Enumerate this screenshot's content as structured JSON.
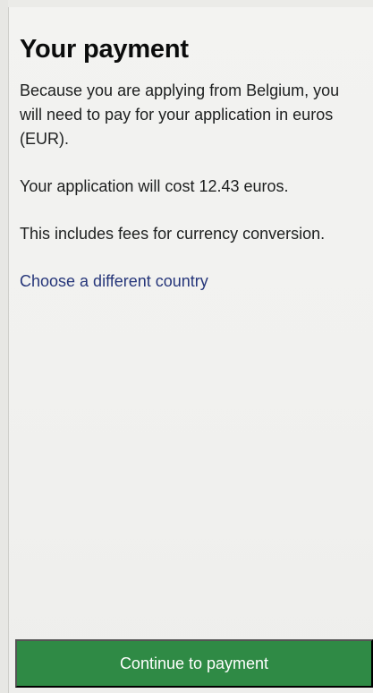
{
  "page": {
    "title": "Your payment",
    "paragraphs": [
      "Because you are applying from Belgium, you will need to pay for your application in euros (EUR).",
      "Your application will cost 12.43 euros.",
      "This includes fees for currency conversion."
    ],
    "link_text": "Choose a different country"
  },
  "footer": {
    "button_label": "Continue to payment"
  },
  "colors": {
    "background": "#f3f3f1",
    "text": "#0b0c0c",
    "link": "#26367a",
    "button": "#2f8a45",
    "button_text": "#ffffff"
  }
}
